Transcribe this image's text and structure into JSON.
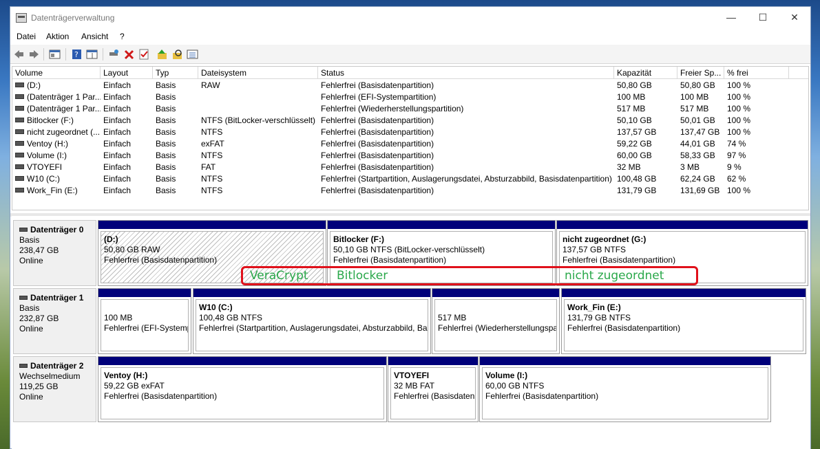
{
  "window": {
    "title": "Datenträgerverwaltung"
  },
  "controls": {
    "minimize": "—",
    "maximize": "☐",
    "close": "✕"
  },
  "menu": [
    "Datei",
    "Aktion",
    "Ansicht",
    "?"
  ],
  "toolbar_icons": [
    "back-icon",
    "forward-icon",
    "console-icon",
    "help-icon",
    "properties-icon",
    "connect-icon",
    "delete-icon",
    "check-icon",
    "up-icon",
    "search-icon",
    "list-icon"
  ],
  "volumes": {
    "columns": [
      "Volume",
      "Layout",
      "Typ",
      "Dateisystem",
      "Status",
      "Kapazität",
      "Freier Sp...",
      "% frei"
    ],
    "rows": [
      [
        "(D:)",
        "Einfach",
        "Basis",
        "RAW",
        "Fehlerfrei (Basisdatenpartition)",
        "50,80 GB",
        "50,80 GB",
        "100 %"
      ],
      [
        "(Datenträger 1 Par...",
        "Einfach",
        "Basis",
        "",
        "Fehlerfrei (EFI-Systempartition)",
        "100 MB",
        "100 MB",
        "100 %"
      ],
      [
        "(Datenträger 1 Par...",
        "Einfach",
        "Basis",
        "",
        "Fehlerfrei (Wiederherstellungspartition)",
        "517 MB",
        "517 MB",
        "100 %"
      ],
      [
        "Bitlocker (F:)",
        "Einfach",
        "Basis",
        "NTFS (BitLocker-verschlüsselt)",
        "Fehlerfrei (Basisdatenpartition)",
        "50,10 GB",
        "50,01 GB",
        "100 %"
      ],
      [
        "nicht zugeordnet (...",
        "Einfach",
        "Basis",
        "NTFS",
        "Fehlerfrei (Basisdatenpartition)",
        "137,57 GB",
        "137,47 GB",
        "100 %"
      ],
      [
        "Ventoy (H:)",
        "Einfach",
        "Basis",
        "exFAT",
        "Fehlerfrei (Basisdatenpartition)",
        "59,22 GB",
        "44,01 GB",
        "74 %"
      ],
      [
        "Volume (I:)",
        "Einfach",
        "Basis",
        "NTFS",
        "Fehlerfrei (Basisdatenpartition)",
        "60,00 GB",
        "58,33 GB",
        "97 %"
      ],
      [
        "VTOYEFI",
        "Einfach",
        "Basis",
        "FAT",
        "Fehlerfrei (Basisdatenpartition)",
        "32 MB",
        "3 MB",
        "9 %"
      ],
      [
        "W10 (C:)",
        "Einfach",
        "Basis",
        "NTFS",
        "Fehlerfrei (Startpartition, Auslagerungsdatei, Absturzabbild, Basisdatenpartition)",
        "100,48 GB",
        "62,24 GB",
        "62 %"
      ],
      [
        "Work_Fin (E:)",
        "Einfach",
        "Basis",
        "NTFS",
        "Fehlerfrei (Basisdatenpartition)",
        "131,79 GB",
        "131,69 GB",
        "100 %"
      ]
    ]
  },
  "disks": [
    {
      "name": "Datenträger 0",
      "type": "Basis",
      "size": "238,47 GB",
      "state": "Online",
      "partitions": [
        {
          "name": "(D:)",
          "size": "50,80 GB RAW",
          "status": "Fehlerfrei (Basisdatenpartition)"
        },
        {
          "name": "Bitlocker  (F:)",
          "size": "50,10 GB NTFS (BitLocker-verschlüsselt)",
          "status": "Fehlerfrei (Basisdatenpartition)"
        },
        {
          "name": "nicht zugeordnet  (G:)",
          "size": "137,57 GB NTFS",
          "status": "Fehlerfrei (Basisdatenpartition)"
        }
      ]
    },
    {
      "name": "Datenträger 1",
      "type": "Basis",
      "size": "232,87 GB",
      "state": "Online",
      "partitions": [
        {
          "name": "",
          "size": "100 MB",
          "status": "Fehlerfrei (EFI-Systemp"
        },
        {
          "name": "W10  (C:)",
          "size": "100,48 GB NTFS",
          "status": "Fehlerfrei (Startpartition, Auslagerungsdatei, Absturzabbild, Bas"
        },
        {
          "name": "",
          "size": "517 MB",
          "status": "Fehlerfrei (Wiederherstellungspar"
        },
        {
          "name": "Work_Fin  (E:)",
          "size": "131,79 GB NTFS",
          "status": "Fehlerfrei (Basisdatenpartition)"
        }
      ]
    },
    {
      "name": "Datenträger 2",
      "type": "Wechselmedium",
      "size": "119,25 GB",
      "state": "Online",
      "partitions": [
        {
          "name": "Ventoy  (H:)",
          "size": "59,22 GB exFAT",
          "status": "Fehlerfrei (Basisdatenpartition)"
        },
        {
          "name": "VTOYEFI",
          "size": "32 MB FAT",
          "status": "Fehlerfrei (Basisdatenp"
        },
        {
          "name": "Volume  (I:)",
          "size": "60,00 GB NTFS",
          "status": "Fehlerfrei (Basisdatenpartition)"
        }
      ]
    }
  ],
  "annotation": {
    "labels": [
      "VeraCrypt",
      "Bitlocker",
      "nicht zugeordnet"
    ],
    "border_color": "#e0101a",
    "text_color": "#2aa84a"
  }
}
